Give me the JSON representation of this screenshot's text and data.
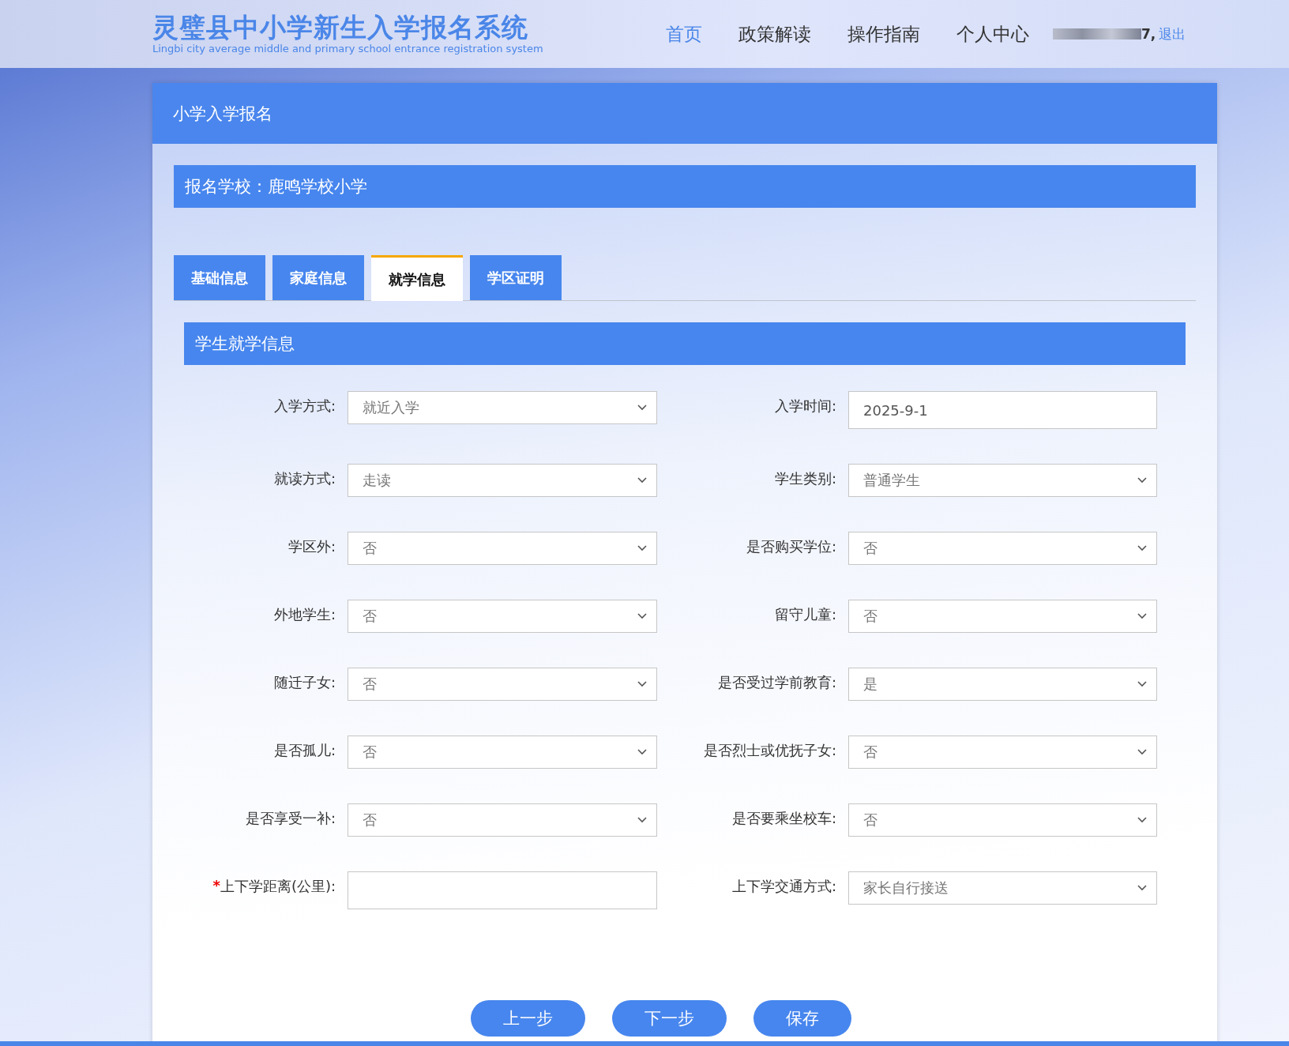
{
  "header": {
    "title": "灵璧县中小学新生入学报名系统",
    "subtitle": "Lingbi city average middle and primary school entrance registration system",
    "nav": [
      {
        "label": "首页",
        "selected": true
      },
      {
        "label": "政策解读",
        "selected": false
      },
      {
        "label": "操作指南",
        "selected": false
      },
      {
        "label": "个人中心",
        "selected": false
      }
    ],
    "user": "7,",
    "logout": "退出"
  },
  "panel_title": "小学入学报名",
  "school_bar": "报名学校：鹿鸣学校小学",
  "tabs": [
    {
      "label": "基础信息",
      "selected": false
    },
    {
      "label": "家庭信息",
      "selected": false
    },
    {
      "label": "就学信息",
      "selected": true
    },
    {
      "label": "学区证明",
      "selected": false
    }
  ],
  "section_title": "学生就学信息",
  "fields": [
    {
      "label": "入学方式:",
      "kind": "select",
      "value": "就近入学"
    },
    {
      "label": "入学时间:",
      "kind": "input",
      "value": "2025-9-1"
    },
    {
      "label": "就读方式:",
      "kind": "select",
      "value": "走读"
    },
    {
      "label": "学生类别:",
      "kind": "select",
      "value": "普通学生"
    },
    {
      "label": "学区外:",
      "kind": "select",
      "value": "否"
    },
    {
      "label": "是否购买学位:",
      "kind": "select",
      "value": "否"
    },
    {
      "label": "外地学生:",
      "kind": "select",
      "value": "否"
    },
    {
      "label": "留守儿童:",
      "kind": "select",
      "value": "否"
    },
    {
      "label": "随迁子女:",
      "kind": "select",
      "value": "否"
    },
    {
      "label": "是否受过学前教育:",
      "kind": "select",
      "value": "是"
    },
    {
      "label": "是否孤儿:",
      "kind": "select",
      "value": "否"
    },
    {
      "label": "是否烈士或优抚子女:",
      "kind": "select",
      "value": "否"
    },
    {
      "label": "是否享受一补:",
      "kind": "select",
      "value": "否"
    },
    {
      "label": "是否要乘坐校车:",
      "kind": "select",
      "value": "否"
    },
    {
      "label": "上下学距离(公里):",
      "kind": "input",
      "required_mark": "*"
    },
    {
      "label": "上下学交通方式:",
      "kind": "select",
      "value": "家长自行接送"
    }
  ],
  "buttons": [
    "上一步",
    "下一步",
    "保存"
  ]
}
